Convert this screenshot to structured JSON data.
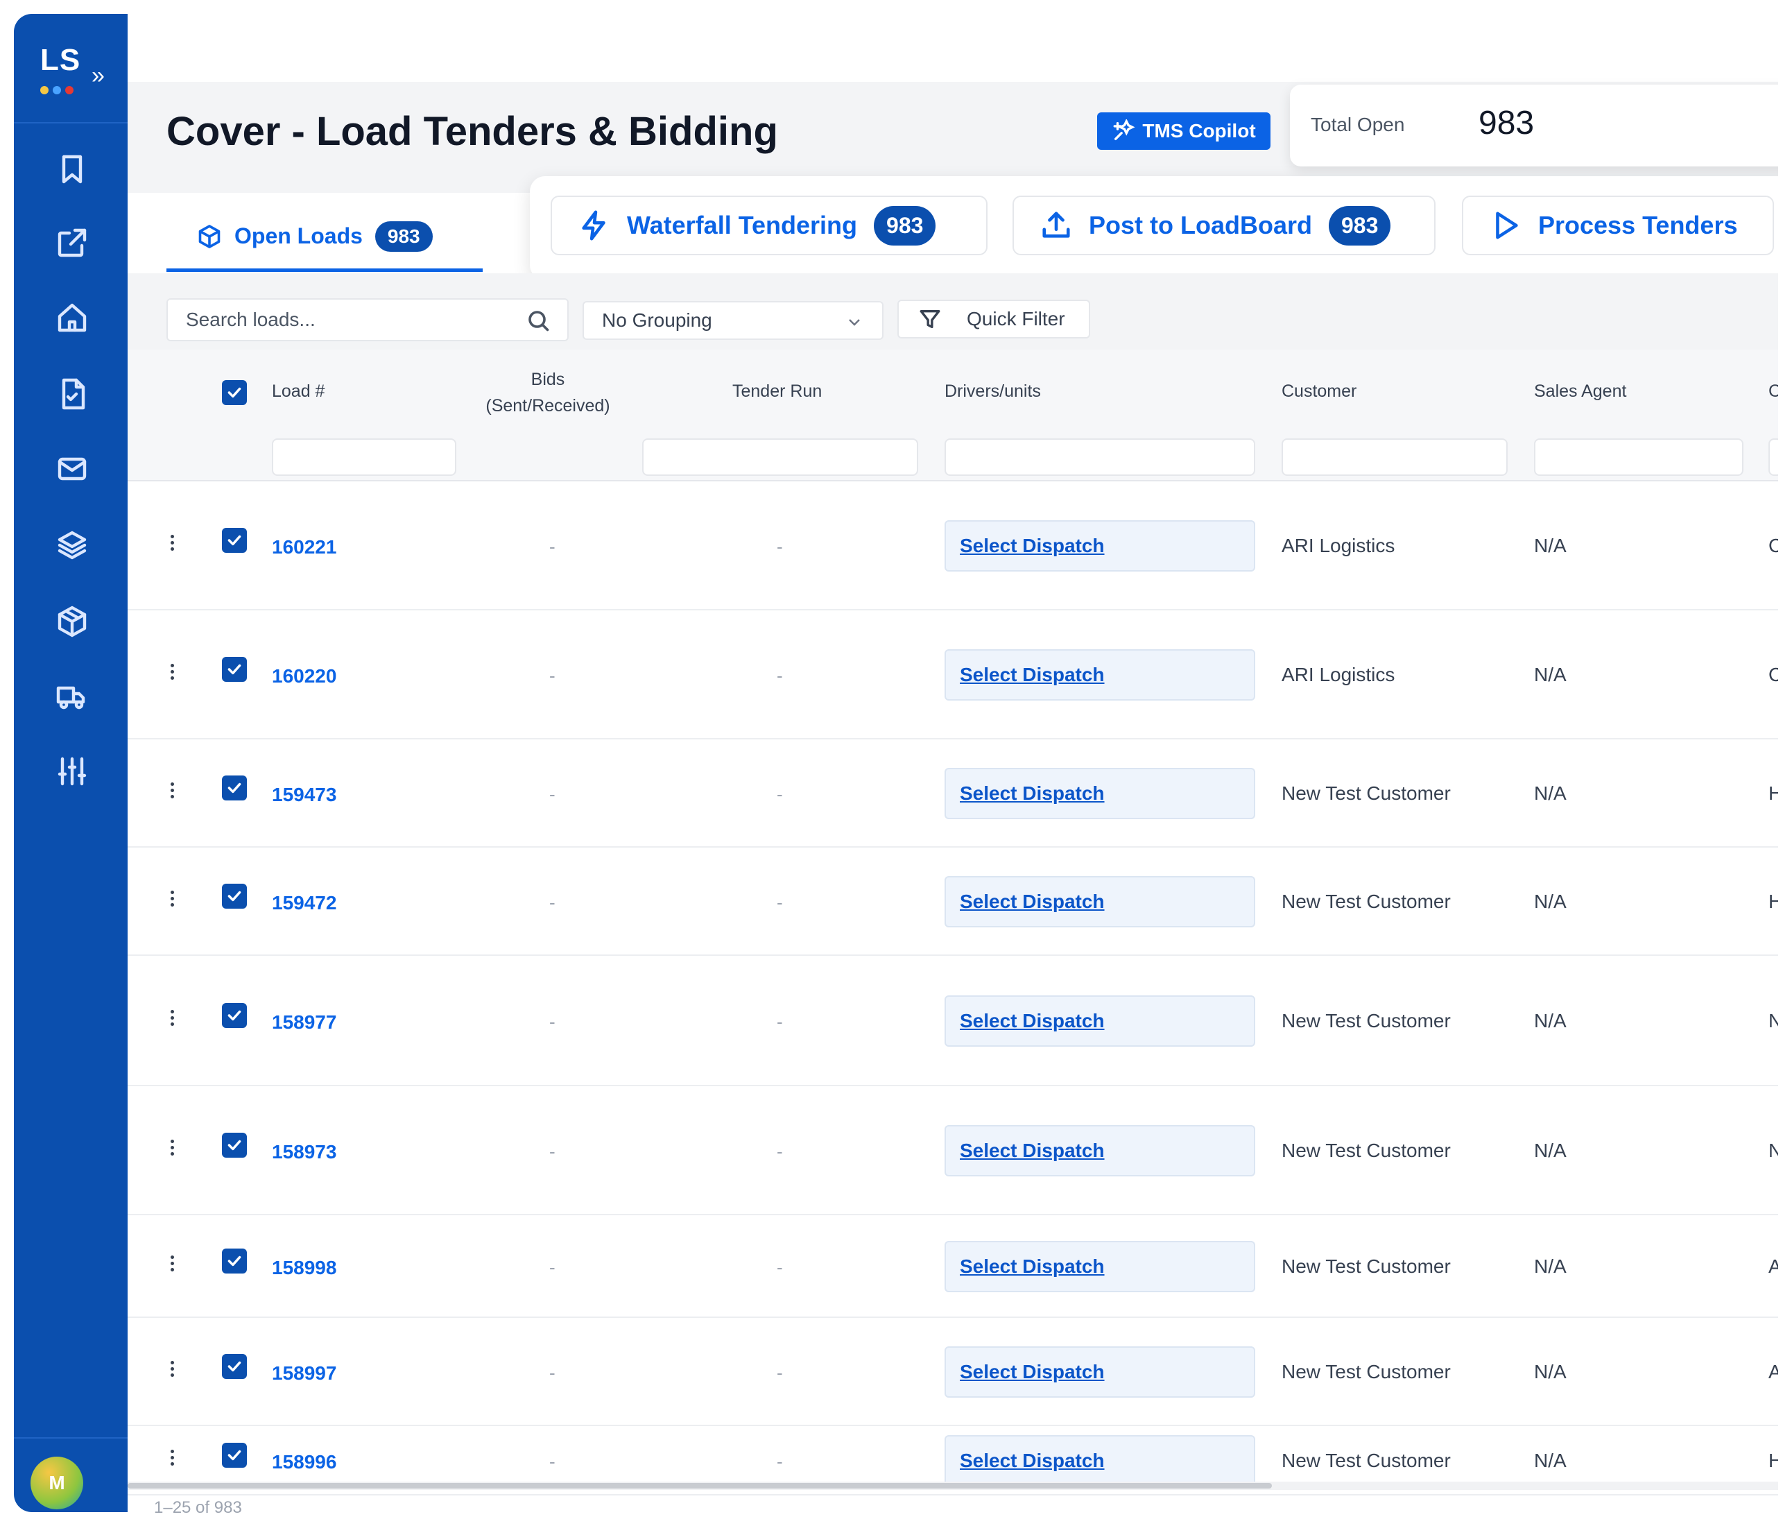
{
  "sidebar": {
    "logo": "LS",
    "expand_glyph": "»",
    "logo_dot_colors": [
      "#f6c744",
      "#4aa3ff",
      "#e53935"
    ],
    "icons": [
      "bookmark-icon",
      "external-link-icon",
      "home-icon",
      "document-check-icon",
      "mail-icon",
      "layers-icon",
      "package-icon",
      "truck-icon",
      "sliders-icon"
    ],
    "avatar_initial": "M"
  },
  "header": {
    "title": "Cover - Load Tenders & Bidding",
    "copilot_label": "TMS Copilot",
    "total_open_label": "Total Open",
    "total_open_value": "983"
  },
  "tabs": {
    "open_loads_label": "Open Loads",
    "open_loads_count": "983"
  },
  "actions": {
    "waterfall_label": "Waterfall Tendering",
    "waterfall_count": "983",
    "post_label": "Post to LoadBoard",
    "post_count": "983",
    "process_label": "Process Tenders"
  },
  "toolbar": {
    "search_placeholder": "Search loads...",
    "grouping_value": "No Grouping",
    "quick_filter_label": "Quick Filter"
  },
  "table": {
    "columns": {
      "load": "Load #",
      "bids_line1": "Bids",
      "bids_line2": "(Sent/Received)",
      "tender_run": "Tender Run",
      "drivers": "Drivers/units",
      "customer": "Customer",
      "sales_agent": "Sales Agent",
      "next_partial": "C"
    },
    "rows": [
      {
        "load": "160221",
        "bids": "-",
        "tender": "-",
        "dispatch": "Select Dispatch",
        "customer": "ARI Logistics",
        "agent": "N/A",
        "next": "C"
      },
      {
        "load": "160220",
        "bids": "-",
        "tender": "-",
        "dispatch": "Select Dispatch",
        "customer": "ARI Logistics",
        "agent": "N/A",
        "next": "C"
      },
      {
        "load": "159473",
        "bids": "-",
        "tender": "-",
        "dispatch": "Select Dispatch",
        "customer": "New Test Customer",
        "agent": "N/A",
        "next": "H"
      },
      {
        "load": "159472",
        "bids": "-",
        "tender": "-",
        "dispatch": "Select Dispatch",
        "customer": "New Test Customer",
        "agent": "N/A",
        "next": "H"
      },
      {
        "load": "158977",
        "bids": "-",
        "tender": "-",
        "dispatch": "Select Dispatch",
        "customer": "New Test Customer",
        "agent": "N/A",
        "next": "N"
      },
      {
        "load": "158973",
        "bids": "-",
        "tender": "-",
        "dispatch": "Select Dispatch",
        "customer": "New Test Customer",
        "agent": "N/A",
        "next": "N"
      },
      {
        "load": "158998",
        "bids": "-",
        "tender": "-",
        "dispatch": "Select Dispatch",
        "customer": "New Test Customer",
        "agent": "N/A",
        "next": "A"
      },
      {
        "load": "158997",
        "bids": "-",
        "tender": "-",
        "dispatch": "Select Dispatch",
        "customer": "New Test Customer",
        "agent": "N/A",
        "next": "A"
      },
      {
        "load": "158996",
        "bids": "-",
        "tender": "-",
        "dispatch": "Select Dispatch",
        "customer": "New Test Customer",
        "agent": "N/A",
        "next": "H"
      }
    ]
  },
  "pager": "1–25 of 983",
  "colors": {
    "sidebar": "#0b4fae",
    "accent": "#0b63e5",
    "badge": "#0b4fae"
  }
}
